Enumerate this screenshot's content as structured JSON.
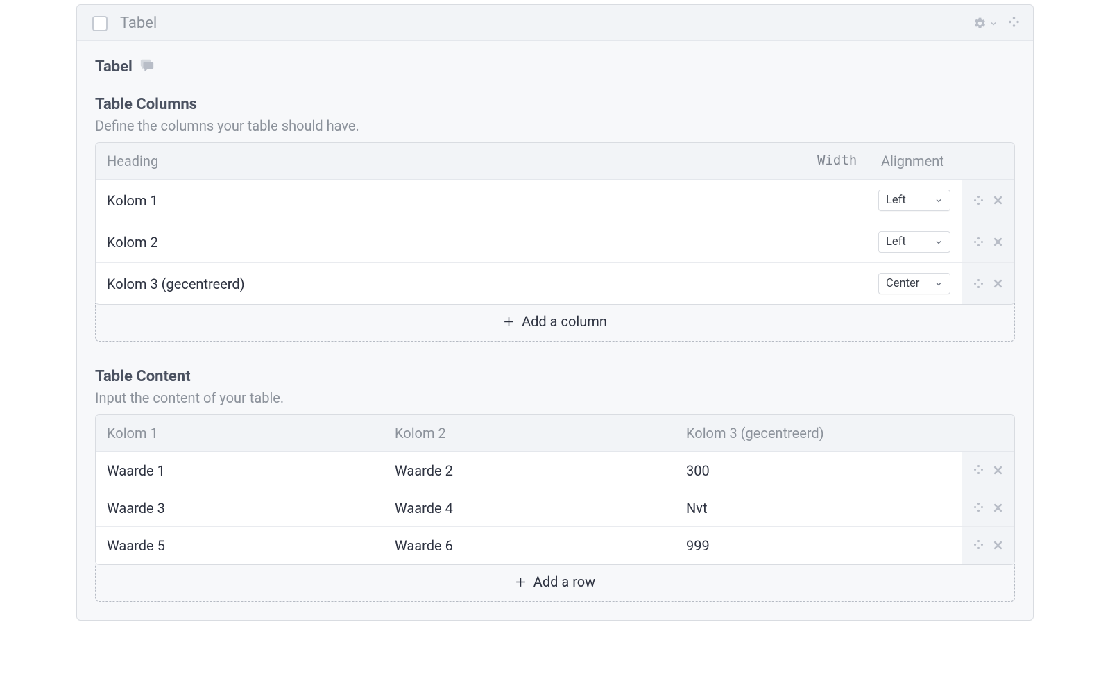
{
  "panel": {
    "header_label": "Tabel",
    "object_title": "Tabel"
  },
  "columns_section": {
    "title": "Table Columns",
    "description": "Define the columns your table should have.",
    "headers": {
      "heading": "Heading",
      "width": "Width",
      "alignment": "Alignment"
    },
    "rows": [
      {
        "heading": "Kolom 1",
        "width": "",
        "alignment": "Left"
      },
      {
        "heading": "Kolom 2",
        "width": "",
        "alignment": "Left"
      },
      {
        "heading": "Kolom 3 (gecentreerd)",
        "width": "",
        "alignment": "Center"
      }
    ],
    "add_label": "Add a column"
  },
  "content_section": {
    "title": "Table Content",
    "description": "Input the content of your table.",
    "headers": [
      "Kolom 1",
      "Kolom 2",
      "Kolom 3 (gecentreerd)"
    ],
    "rows": [
      [
        "Waarde 1",
        "Waarde 2",
        "300"
      ],
      [
        "Waarde 3",
        "Waarde 4",
        "Nvt"
      ],
      [
        "Waarde 5",
        "Waarde 6",
        "999"
      ]
    ],
    "add_label": "Add a row"
  }
}
